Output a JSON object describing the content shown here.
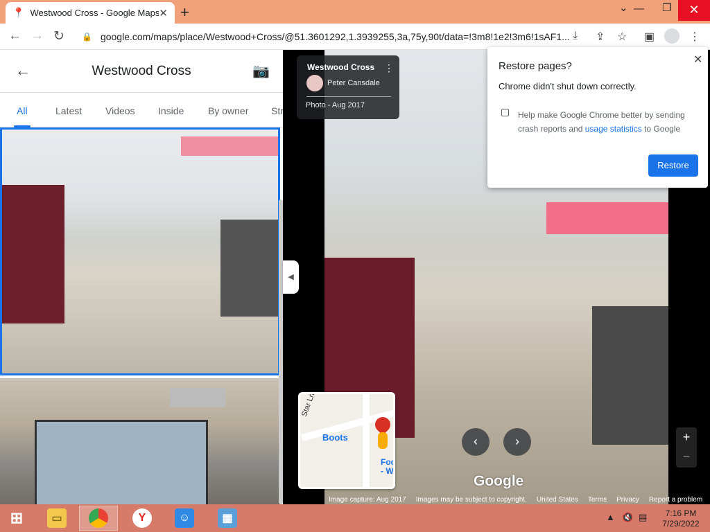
{
  "tab": {
    "title": "Westwood Cross - Google Maps",
    "close": "✕"
  },
  "newtab": "+",
  "window": {
    "minimize": "⌄",
    "restore": "❐",
    "close": "✕",
    "dash": "—"
  },
  "toolbar": {
    "back": "←",
    "forward": "→",
    "reload": "↻",
    "url": "google.com/maps/place/Westwood+Cross/@51.3601292,1.3939255,3a,75y,90t/data=!3m8!1e2!3m6!1sAF1..."
  },
  "panel": {
    "back": "←",
    "title": "Westwood Cross",
    "tabs": [
      "All",
      "Latest",
      "Videos",
      "Inside",
      "By owner",
      "Str"
    ]
  },
  "collapse": "◀",
  "info_card": {
    "title": "Westwood Cross",
    "more": "⋮",
    "author": "Peter Cansdale",
    "date": "Photo - Aug 2017"
  },
  "minimap": {
    "street": "Star Ln",
    "boots": "Boots",
    "food": "Foo\n- We",
    "right_label": "W"
  },
  "nav": {
    "prev": "‹",
    "next": "›"
  },
  "zoom": {
    "in": "+",
    "out": "−"
  },
  "logo": "Google",
  "footer": [
    "Image capture: Aug 2017",
    "Images may be subject to copyright.",
    "United States",
    "Terms",
    "Privacy",
    "Report a problem"
  ],
  "popup": {
    "title": "Restore pages?",
    "close": "✕",
    "message": "Chrome didn't shut down correctly.",
    "checkbox_text": "Help make Google Chrome better by sending crash reports and ",
    "link_text": "usage statistics",
    "checkbox_tail": " to Google",
    "button": "Restore"
  },
  "taskbar": {
    "time": "7:16 PM",
    "date": "7/29/2022"
  },
  "colors": {
    "accent": "#1a73e8",
    "titlebar": "#f2a27a",
    "taskbar": "#d67a6a",
    "close_red": "#e81123"
  }
}
